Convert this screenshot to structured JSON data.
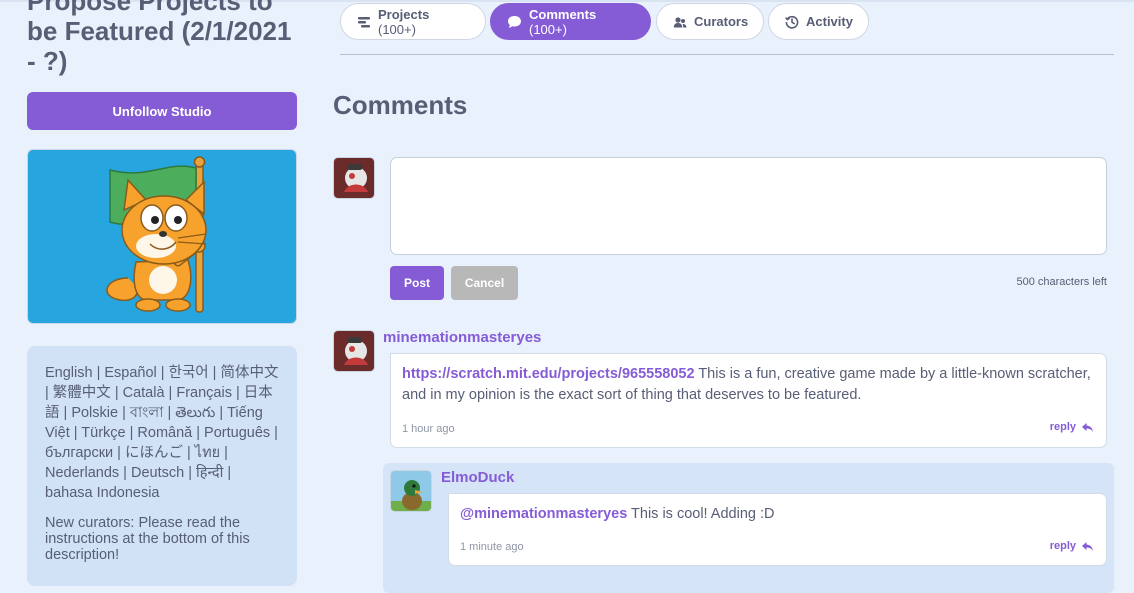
{
  "studio": {
    "title": "Propose Projects to be Featured (2/1/2021 - ?)",
    "unfollow_label": "Unfollow Studio",
    "description_languages": "English | Español | 한국어 | 简体中文 | 繁體中文 | Català | Français | 日本語 | Polskie | বাংলা | తెలుగు | Tiếng Việt | Türkçe | Română | Português | български | にほんご | ไทย | Nederlands | Deutsch | हिन्दी | bahasa Indonesia",
    "description_curators": "New curators: Please read the instructions at the bottom of this description!"
  },
  "tabs": [
    {
      "label": "Projects",
      "count": "(100+)",
      "icon": "projects-icon",
      "active": false
    },
    {
      "label": "Comments",
      "count": "(100+)",
      "icon": "comment-bubble-icon",
      "active": true
    },
    {
      "label": "Curators",
      "count": "",
      "icon": "curators-icon",
      "active": false
    },
    {
      "label": "Activity",
      "count": "",
      "icon": "activity-history-icon",
      "active": false
    }
  ],
  "comments": {
    "heading": "Comments",
    "compose": {
      "placeholder": "",
      "post_label": "Post",
      "cancel_label": "Cancel",
      "chars_left": "500 characters left"
    },
    "items": [
      {
        "username": "minemationmasteryes",
        "link": "https://scratch.mit.edu/projects/965558052",
        "text": " This is a fun, creative game made by a little-known scratcher, and in my opinion is the exact sort of thing that deserves to be featured.",
        "time": "1 hour ago",
        "reply_label": "reply",
        "replies": [
          {
            "username": "ElmoDuck",
            "mention": "@minemationmasteryes",
            "text": " This is cool! Adding :D",
            "time": "1 minute ago",
            "reply_label": "reply"
          }
        ]
      }
    ]
  },
  "colors": {
    "accent": "#855cd6",
    "page_bg": "#e9f1fc",
    "thumbnail_bg": "#26a5df",
    "description_bg": "#d1e1f6",
    "reply_thread_bg": "#d6e4f7",
    "text": "#575e75"
  }
}
